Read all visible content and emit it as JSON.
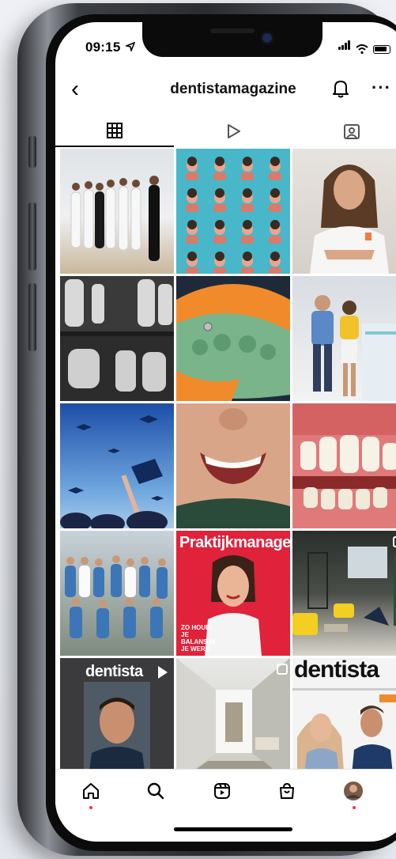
{
  "status_bar": {
    "time": "09:15"
  },
  "header": {
    "username": "dentistamagazine"
  },
  "tabs": [
    {
      "name": "grid",
      "icon": "grid-icon",
      "active": true
    },
    {
      "name": "reels",
      "icon": "play-icon",
      "active": false
    },
    {
      "name": "tagged",
      "icon": "tagged-person-icon",
      "active": false
    }
  ],
  "posts": {
    "magazine_red": {
      "title": "Praktijkmanager",
      "headline": "ZO HOUD JE BALANS IN JE WERK"
    },
    "magazine_dark": {
      "title": "dentista"
    },
    "magazine_white": {
      "title": "dentista"
    }
  },
  "bottom_nav": [
    {
      "name": "home",
      "icon": "home-icon"
    },
    {
      "name": "search",
      "icon": "search-icon"
    },
    {
      "name": "reels",
      "icon": "reels-icon"
    },
    {
      "name": "shop",
      "icon": "shop-icon"
    },
    {
      "name": "profile",
      "icon": "avatar"
    }
  ],
  "colors": {
    "notification_dot": "#ff3040",
    "magazine_red": "#e0223a"
  }
}
